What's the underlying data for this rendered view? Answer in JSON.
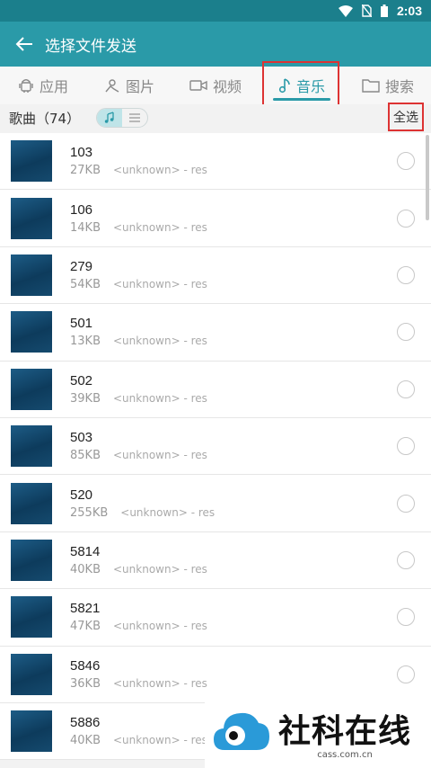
{
  "status_bar": {
    "time": "2:03"
  },
  "app_bar": {
    "title": "选择文件发送"
  },
  "tabs": [
    {
      "label": "应用",
      "icon": "android-icon"
    },
    {
      "label": "图片",
      "icon": "image-icon"
    },
    {
      "label": "视频",
      "icon": "video-icon"
    },
    {
      "label": "音乐",
      "icon": "music-note-icon",
      "active": true
    },
    {
      "label": "搜索",
      "icon": "folder-icon"
    }
  ],
  "subheader": {
    "songs_label": "歌曲（74）",
    "select_all": "全选"
  },
  "songs": [
    {
      "name": "103",
      "size": "27KB",
      "artist": "<unknown> - res"
    },
    {
      "name": "106",
      "size": "14KB",
      "artist": "<unknown> - res"
    },
    {
      "name": "279",
      "size": "54KB",
      "artist": "<unknown> - res"
    },
    {
      "name": "501",
      "size": "13KB",
      "artist": "<unknown> - res"
    },
    {
      "name": "502",
      "size": "39KB",
      "artist": "<unknown> - res"
    },
    {
      "name": "503",
      "size": "85KB",
      "artist": "<unknown> - res"
    },
    {
      "name": "520",
      "size": "255KB",
      "artist": "<unknown> - res"
    },
    {
      "name": "5814",
      "size": "40KB",
      "artist": "<unknown> - res"
    },
    {
      "name": "5821",
      "size": "47KB",
      "artist": "<unknown> - res"
    },
    {
      "name": "5846",
      "size": "36KB",
      "artist": "<unknown> - res"
    },
    {
      "name": "5886",
      "size": "40KB",
      "artist": "<unknown> - res"
    }
  ],
  "watermark": {
    "name": "社科在线",
    "url": "cass.com.cn"
  },
  "colors": {
    "accent": "#2a9aa8",
    "status_bar": "#1b7f8c",
    "highlight": "#dd3333"
  }
}
